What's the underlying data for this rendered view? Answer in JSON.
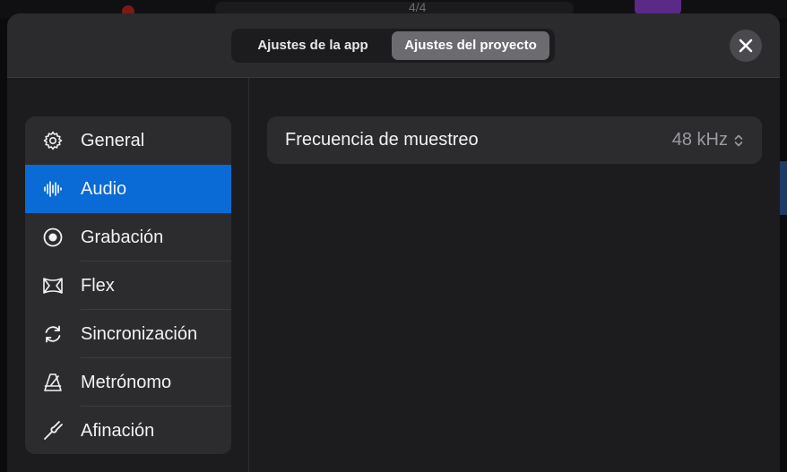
{
  "background": {
    "time_signature": "4/4"
  },
  "header": {
    "segments": [
      {
        "label": "Ajustes de la app",
        "selected": false
      },
      {
        "label": "Ajustes del proyecto",
        "selected": true
      }
    ],
    "close_icon": "close-icon"
  },
  "sidebar": {
    "items": [
      {
        "label": "General",
        "icon": "gear-icon",
        "selected": false
      },
      {
        "label": "Audio",
        "icon": "waveform-icon",
        "selected": true
      },
      {
        "label": "Grabación",
        "icon": "record-icon",
        "selected": false
      },
      {
        "label": "Flex",
        "icon": "flex-icon",
        "selected": false
      },
      {
        "label": "Sincronización",
        "icon": "sync-icon",
        "selected": false
      },
      {
        "label": "Metrónomo",
        "icon": "metronome-icon",
        "selected": false
      },
      {
        "label": "Afinación",
        "icon": "tuning-fork-icon",
        "selected": false
      }
    ]
  },
  "content": {
    "sample_rate": {
      "label": "Frecuencia de muestreo",
      "value": "48 kHz"
    }
  },
  "colors": {
    "accent": "#0a6ad6",
    "panel": "#2c2c2f",
    "background": "#1c1c1e"
  }
}
